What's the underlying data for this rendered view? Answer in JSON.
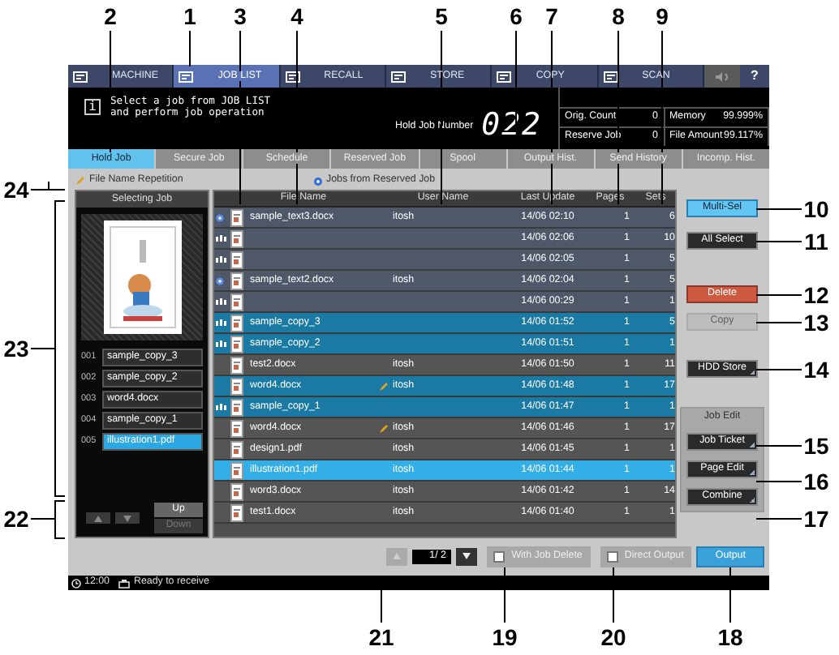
{
  "nav": {
    "items": [
      {
        "label": "MACHINE",
        "selected": false
      },
      {
        "label": "JOB LIST",
        "selected": true
      },
      {
        "label": "RECALL",
        "selected": false
      },
      {
        "label": "STORE",
        "selected": false
      },
      {
        "label": "COPY",
        "selected": false
      },
      {
        "label": "SCAN",
        "selected": false
      }
    ],
    "help": "?"
  },
  "message": {
    "info_glyph": "i",
    "lines": [
      "Select a job from JOB LIST",
      "and perform job operation"
    ],
    "hold_job_label": "Hold Job Number",
    "hold_job_number": "022",
    "counters": [
      {
        "label": "Orig. Count",
        "value": "0"
      },
      {
        "label": "Memory",
        "value": "99.999%"
      },
      {
        "label": "Reserve Job",
        "value": "0"
      },
      {
        "label": "File Amount",
        "value": "99.117%"
      }
    ]
  },
  "tabs": [
    {
      "label": "Hold Job",
      "selected": true
    },
    {
      "label": "Secure Job",
      "selected": false
    },
    {
      "label": "Schedule",
      "selected": false
    },
    {
      "label": "Reserved Job",
      "selected": false
    },
    {
      "label": "Spool",
      "selected": false
    },
    {
      "label": "Output Hist.",
      "selected": false
    },
    {
      "label": "Send History",
      "selected": false
    },
    {
      "label": "Incomp. Hist.",
      "selected": false
    }
  ],
  "legend": {
    "repetition": "File Name Repetition",
    "reserved": "Jobs from Reserved Job"
  },
  "selecting_job": {
    "title": "Selecting Job",
    "items": [
      {
        "number": "001",
        "name": "sample_copy_3",
        "selected": false
      },
      {
        "number": "002",
        "name": "sample_copy_2",
        "selected": false
      },
      {
        "number": "003",
        "name": "word4.docx",
        "selected": false
      },
      {
        "number": "004",
        "name": "sample_copy_1",
        "selected": false
      },
      {
        "number": "005",
        "name": "illustration1.pdf",
        "selected": true
      }
    ],
    "up": {
      "label": "Up",
      "disabled": false
    },
    "down": {
      "label": "Down",
      "disabled": true
    }
  },
  "table": {
    "columns": [
      "File Name",
      "User Name",
      "Last Update",
      "Pages",
      "Sets"
    ],
    "rows": [
      {
        "kind": "reserved",
        "file_name": "sample_text3.docx",
        "repeated": false,
        "user": "itosh",
        "updated": "14/06 02:10",
        "pages": "1",
        "sets": "6",
        "selected": false,
        "current": false
      },
      {
        "kind": "scan",
        "repeated": false,
        "updated": "14/06 02:06",
        "pages": "1",
        "sets": "10",
        "selected": false,
        "current": false
      },
      {
        "kind": "scan",
        "repeated": false,
        "updated": "14/06 02:05",
        "pages": "1",
        "sets": "5",
        "selected": false,
        "current": false
      },
      {
        "kind": "reserved",
        "file_name": "sample_text2.docx",
        "repeated": false,
        "user": "itosh",
        "updated": "14/06 02:04",
        "pages": "1",
        "sets": "5",
        "selected": false,
        "current": false
      },
      {
        "kind": "scan",
        "repeated": false,
        "updated": "14/06 00:29",
        "pages": "1",
        "sets": "1",
        "selected": false,
        "current": false
      },
      {
        "kind": "scan",
        "file_name": "sample_copy_3",
        "repeated": false,
        "updated": "14/06 01:52",
        "pages": "1",
        "sets": "5",
        "selected": true,
        "current": false
      },
      {
        "kind": "scan",
        "file_name": "sample_copy_2",
        "repeated": false,
        "updated": "14/06 01:51",
        "pages": "1",
        "sets": "1",
        "selected": true,
        "current": false
      },
      {
        "kind": "plain",
        "file_name": "test2.docx",
        "repeated": false,
        "user": "itosh",
        "updated": "14/06 01:50",
        "pages": "1",
        "sets": "11",
        "selected": false,
        "current": false
      },
      {
        "kind": "plain",
        "file_name": "word4.docx",
        "repeated": true,
        "user": "itosh",
        "updated": "14/06 01:48",
        "pages": "1",
        "sets": "17",
        "selected": true,
        "current": false
      },
      {
        "kind": "scan",
        "file_name": "sample_copy_1",
        "repeated": false,
        "updated": "14/06 01:47",
        "pages": "1",
        "sets": "1",
        "selected": true,
        "current": false
      },
      {
        "kind": "plain",
        "file_name": "word4.docx",
        "repeated": true,
        "user": "itosh",
        "updated": "14/06 01:46",
        "pages": "1",
        "sets": "17",
        "selected": false,
        "current": false
      },
      {
        "kind": "plain",
        "file_name": "design1.pdf",
        "repeated": false,
        "user": "itosh",
        "updated": "14/06 01:45",
        "pages": "1",
        "sets": "1",
        "selected": false,
        "current": false
      },
      {
        "kind": "plain",
        "file_name": "illustration1.pdf",
        "repeated": false,
        "user": "itosh",
        "updated": "14/06 01:44",
        "pages": "1",
        "sets": "1",
        "selected": true,
        "current": true
      },
      {
        "kind": "plain",
        "file_name": "word3.docx",
        "repeated": false,
        "user": "itosh",
        "updated": "14/06 01:42",
        "pages": "1",
        "sets": "14",
        "selected": false,
        "current": false
      },
      {
        "kind": "plain",
        "file_name": "test1.docx",
        "repeated": false,
        "user": "itosh",
        "updated": "14/06 01:40",
        "pages": "1",
        "sets": "1",
        "selected": false,
        "current": false
      }
    ]
  },
  "side_buttons": [
    {
      "label": "Multi-Sel",
      "kind": "toggle",
      "on": true,
      "disabled": false
    },
    {
      "label": "All Select",
      "kind": "action",
      "on": false,
      "disabled": false
    },
    {
      "label": "Delete",
      "kind": "danger",
      "on": false,
      "disabled": false
    },
    {
      "label": "Copy",
      "kind": "action",
      "on": false,
      "disabled": true
    },
    {
      "label": "HDD Store",
      "kind": "menu",
      "on": false,
      "disabled": false
    }
  ],
  "job_edit": {
    "title": "Job Edit",
    "buttons": [
      {
        "label": "Job Ticket",
        "disabled": false
      },
      {
        "label": "Page Edit",
        "disabled": false
      },
      {
        "label": "Combine",
        "disabled": false
      }
    ]
  },
  "pager": {
    "page": "1/ 2",
    "up_disabled": true,
    "down_disabled": false
  },
  "options": [
    {
      "label": "With Job Delete",
      "checked": false
    },
    {
      "label": "Direct Output",
      "checked": false
    }
  ],
  "output_button": "Output",
  "status": {
    "time": "12:00",
    "message": "Ready to receive"
  },
  "callouts": [
    {
      "number": "2"
    },
    {
      "number": "1"
    },
    {
      "number": "3"
    },
    {
      "number": "4"
    },
    {
      "number": "5"
    },
    {
      "number": "6"
    },
    {
      "number": "7"
    },
    {
      "number": "8"
    },
    {
      "number": "9"
    },
    {
      "number": "10"
    },
    {
      "number": "11"
    },
    {
      "number": "12"
    },
    {
      "number": "13"
    },
    {
      "number": "14"
    },
    {
      "number": "15"
    },
    {
      "number": "16"
    },
    {
      "number": "17"
    },
    {
      "number": "24"
    },
    {
      "number": "23"
    },
    {
      "number": "22"
    },
    {
      "number": "21"
    },
    {
      "number": "19"
    },
    {
      "number": "20"
    },
    {
      "number": "18"
    }
  ]
}
